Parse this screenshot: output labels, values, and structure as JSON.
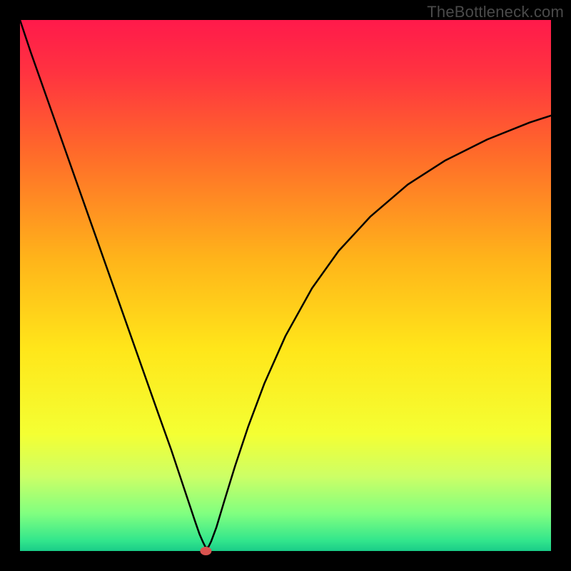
{
  "watermark": "TheBottleneck.com",
  "chart_data": {
    "type": "line",
    "title": "",
    "xlabel": "",
    "ylabel": "",
    "xlim": [
      0,
      100
    ],
    "ylim": [
      0,
      100
    ],
    "grid": false,
    "legend": false,
    "background_gradient_stops": [
      {
        "offset": 0.0,
        "color": "#ff1a4b"
      },
      {
        "offset": 0.1,
        "color": "#ff3340"
      },
      {
        "offset": 0.25,
        "color": "#ff6a2a"
      },
      {
        "offset": 0.45,
        "color": "#ffb41a"
      },
      {
        "offset": 0.62,
        "color": "#ffe61a"
      },
      {
        "offset": 0.78,
        "color": "#f4ff33"
      },
      {
        "offset": 0.86,
        "color": "#ccff66"
      },
      {
        "offset": 0.93,
        "color": "#80ff80"
      },
      {
        "offset": 0.98,
        "color": "#33e68c"
      },
      {
        "offset": 1.0,
        "color": "#1acc88"
      }
    ],
    "series": [
      {
        "name": "curve",
        "color": "#000000",
        "x": [
          0,
          2,
          5,
          8,
          11,
          14,
          17,
          20,
          23,
          26,
          28.5,
          30.5,
          32,
          33,
          33.8,
          34.5,
          35,
          35.5,
          36,
          37,
          38.5,
          40.5,
          43,
          46,
          50,
          55,
          60,
          66,
          73,
          80,
          88,
          96,
          100
        ],
        "y": [
          100,
          94,
          85.5,
          77,
          68.5,
          60,
          51.5,
          43,
          34.5,
          26,
          19,
          13,
          8.5,
          5.5,
          3.2,
          1.6,
          0.6,
          0.8,
          1.8,
          4.5,
          9.5,
          16,
          23.5,
          31.5,
          40.5,
          49.5,
          56.5,
          63,
          69,
          73.5,
          77.5,
          80.7,
          82
        ]
      }
    ],
    "marker": {
      "x": 35,
      "y": 0,
      "color": "#d9534f"
    }
  }
}
